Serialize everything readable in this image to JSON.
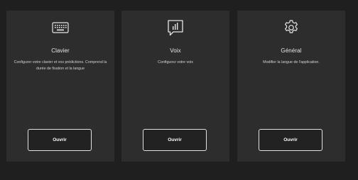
{
  "cards": [
    {
      "icon": "keyboard-icon",
      "title": "Clavier",
      "description": "Configurer votre clavier et vos prédictions. Comprend la durée de fixation et la langue",
      "button_label": "Ouvrir"
    },
    {
      "icon": "voice-bars-icon",
      "title": "Voix",
      "description": "Configurez votre voix",
      "button_label": "Ouvrir"
    },
    {
      "icon": "gear-icon",
      "title": "Général",
      "description": "Modifier la langue de l'application.",
      "button_label": "Ouvrir"
    }
  ],
  "colors": {
    "background": "#1f1f1f",
    "card": "#2d2d2d",
    "text": "#e6e6e6",
    "button_border": "#e3e3e3"
  }
}
